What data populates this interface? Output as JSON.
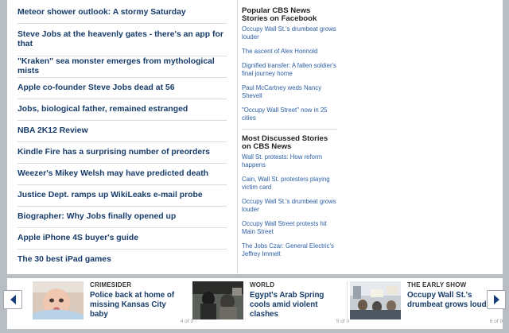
{
  "headlines": [
    "Meteor shower outlook: A stormy Saturday",
    "Steve Jobs at the heavenly gates - there's an app for that",
    "\"Kraken\" sea monster emerges from mythological mists",
    "Apple co-founder Steve Jobs dead at 56",
    "Jobs, biological father, remained estranged",
    "NBA 2K12 Review",
    "Kindle Fire has a surprising number of preorders",
    "Weezer's Mikey Welsh may have predicted death",
    "Justice Dept. ramps up WikiLeaks e-mail probe",
    "Biographer: Why Jobs finally opened up",
    "Apple iPhone 4S buyer's guide",
    "The 30 best iPad games"
  ],
  "facebook": {
    "title": "Popular CBS News Stories on Facebook",
    "items": [
      "Occupy Wall St.'s drumbeat grows louder",
      "The ascent of Alex Honnold",
      "Dignified transfer: A fallen soldier's final journey home",
      "Paul McCartney weds Nancy Shevell",
      "\"Occupy Wall Street\" now in 25 cities"
    ]
  },
  "discussed": {
    "title": "Most Discussed Stories on CBS News",
    "items": [
      "Wall St. protests: How reform happens",
      "Cain, Wall St. protesters playing victim card",
      "Occupy Wall St.'s drumbeat grows louder",
      "Occupy Wall Street protests hit Main Street",
      "The Jobs Czar: General Electric's Jeffrey Immelt"
    ]
  },
  "carousel": {
    "cards": [
      {
        "kicker": "CRIMESIDER",
        "title": "Police back at home of missing Kansas City baby",
        "count": "4 of 9",
        "thumb": "baby-photo"
      },
      {
        "kicker": "WORLD",
        "title": "Egypt's Arab Spring cools amid violent clashes",
        "count": "5 of 9",
        "thumb": "protest-photo"
      },
      {
        "kicker": "THE EARLY SHOW",
        "title": "Occupy Wall St.'s drumbeat grows louder",
        "count": "6 of 9",
        "thumb": "occupy-photo"
      }
    ],
    "prev_icon": "arrow-left-icon",
    "next_icon": "arrow-right-icon"
  },
  "colors": {
    "headline": "#173c6a",
    "link": "#2c5fa3",
    "background": "#b9bec3"
  }
}
